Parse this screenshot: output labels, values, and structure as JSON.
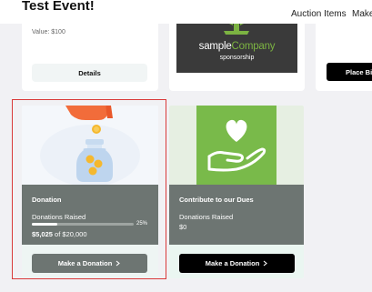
{
  "header": {
    "event_title": "Test Event!",
    "nav": [
      "Auction Items",
      "Make"
    ]
  },
  "top_cards": {
    "left": {
      "value_text": "Value: $100",
      "details_label": "Details"
    },
    "middle": {
      "sponsor_name_part1": "sample",
      "sponsor_name_part2": "Company",
      "sponsor_sub": "sponsorship"
    },
    "right": {
      "place_bid_label": "Place Bi"
    }
  },
  "donation_card": {
    "title": "Donation",
    "subtitle": "Donations Raised",
    "progress_percent_label": "25%",
    "progress_fraction": 0.25,
    "raised_amount": "$5,025",
    "raised_of": "of",
    "raised_goal": "$20,000",
    "button_label": "Make a Donation"
  },
  "dues_card": {
    "title": "Contribute to our Dues",
    "subtitle": "Donations Raised",
    "amount": "$0",
    "button_label": "Make a Donation"
  },
  "icons": {
    "chevron": "chevron-right-icon"
  },
  "colors": {
    "panel_grey": "#6d7572",
    "dues_green": "#79ba4a",
    "selection_red": "#d93a3a"
  }
}
